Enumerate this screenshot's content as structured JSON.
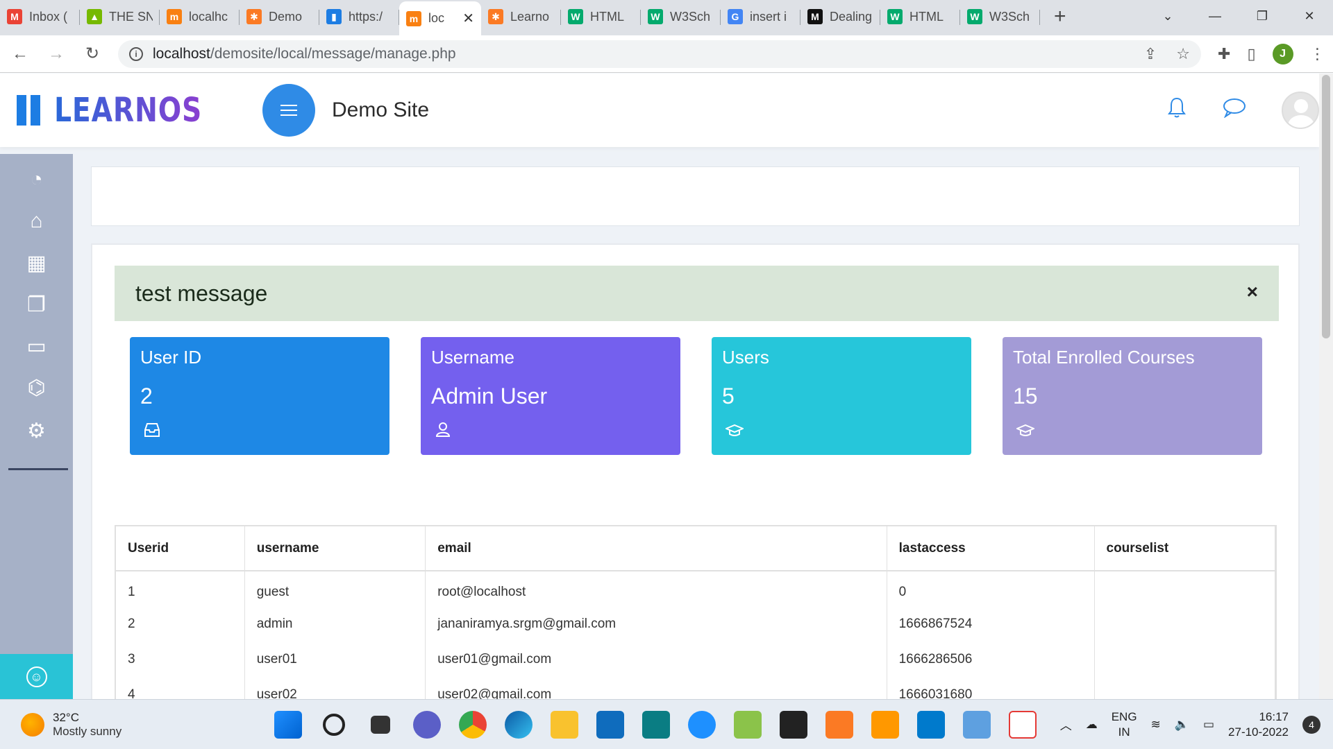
{
  "browser": {
    "tabs": [
      {
        "label": "Inbox (",
        "favicon": "gmail-icon",
        "color": "#ea4335",
        "glyph": "M"
      },
      {
        "label": "THE SN",
        "favicon": "the-sn-icon",
        "color": "#76b900",
        "glyph": "▲"
      },
      {
        "label": "localhc",
        "favicon": "moodle-icon",
        "color": "#f98012",
        "glyph": "m"
      },
      {
        "label": "Demo",
        "favicon": "xampp-icon",
        "color": "#fb7a24",
        "glyph": "✱"
      },
      {
        "label": "https:/",
        "favicon": "learnospace-icon",
        "color": "#1d7de3",
        "glyph": "▮"
      },
      {
        "label": "loc",
        "favicon": "moodle-icon",
        "color": "#f98012",
        "glyph": "m",
        "active": true
      },
      {
        "label": "Learno",
        "favicon": "xampp-icon",
        "color": "#fb7a24",
        "glyph": "✱"
      },
      {
        "label": "HTML",
        "favicon": "w3schools-icon",
        "color": "#04aa6d",
        "glyph": "W"
      },
      {
        "label": "W3Sch",
        "favicon": "w3schools-icon",
        "color": "#04aa6d",
        "glyph": "W"
      },
      {
        "label": "insert i",
        "favicon": "google-icon",
        "color": "#4285f4",
        "glyph": "G"
      },
      {
        "label": "Dealing",
        "favicon": "medium-icon",
        "color": "#111111",
        "glyph": "M"
      },
      {
        "label": "HTML",
        "favicon": "w3schools-icon",
        "color": "#04aa6d",
        "glyph": "W"
      },
      {
        "label": "W3Sch",
        "favicon": "w3schools-icon",
        "color": "#04aa6d",
        "glyph": "W"
      }
    ],
    "url_host": "localhost",
    "url_path": "/demosite/local/message/manage.php",
    "profile_initial": "J"
  },
  "header": {
    "logo_text": "LEARNOSPACE",
    "site_name": "Demo Site"
  },
  "alert": {
    "message": "test message",
    "close": "×"
  },
  "stats": [
    {
      "label": "User ID",
      "value": "2",
      "color": "#1e88e5",
      "icon": "inbox-icon"
    },
    {
      "label": "Username",
      "value": "Admin User",
      "color": "#7460ee",
      "icon": "user-icon"
    },
    {
      "label": "Users",
      "value": "5",
      "color": "#26c6da",
      "icon": "graduation-cap-icon"
    },
    {
      "label": "Total Enrolled Courses",
      "value": "15",
      "color": "#a39bd6",
      "icon": "graduation-cap-icon"
    }
  ],
  "table": {
    "headers": [
      "Userid",
      "username",
      "email",
      "lastaccess",
      "courselist"
    ],
    "rows": [
      [
        "1",
        "guest",
        "root@localhost",
        "0",
        ""
      ],
      [
        "2",
        "admin",
        "jananiramya.srgm@gmail.com",
        "1666867524",
        ""
      ],
      [
        "3",
        "user01",
        "user01@gmail.com",
        "1666286506",
        ""
      ],
      [
        "4",
        "user02",
        "user02@gmail.com",
        "1666031680",
        ""
      ]
    ]
  },
  "taskbar": {
    "temperature": "32°C",
    "weather": "Mostly sunny",
    "lang1": "ENG",
    "lang2": "IN",
    "time": "16:17",
    "date": "27-10-2022",
    "notifications": "4"
  }
}
